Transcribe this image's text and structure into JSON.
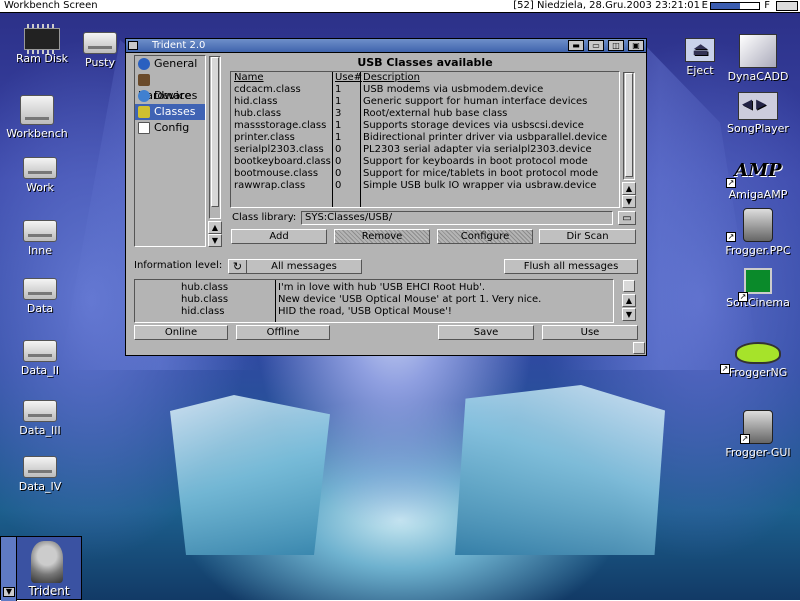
{
  "screen": {
    "title": "Workbench Screen",
    "clock": "[52] Niedziela, 28.Gru.2003 23:21:01",
    "e_label": "E",
    "f_label": "F",
    "e_fill_fraction": 0.6
  },
  "desktop_icons_left": [
    {
      "label": "Ram Disk",
      "icon": "ram-chip-icon"
    },
    {
      "label": "Pusty",
      "icon": "floppy-icon"
    },
    {
      "label": "Workbench",
      "icon": "harddisk-icon"
    },
    {
      "label": "Work",
      "icon": "harddisk-icon"
    },
    {
      "label": "Inne",
      "icon": "harddisk-icon"
    },
    {
      "label": "Data",
      "icon": "harddisk-icon"
    },
    {
      "label": "Data_II",
      "icon": "harddisk-icon"
    },
    {
      "label": "Data_III",
      "icon": "harddisk-icon"
    },
    {
      "label": "Data_IV",
      "icon": "harddisk-icon"
    }
  ],
  "desktop_icons_right": [
    {
      "label": "Eject",
      "icon": "eject-icon"
    },
    {
      "label": "DynaCADD",
      "icon": "cad-icon"
    },
    {
      "label": "SongPlayer",
      "icon": "speaker-icon"
    },
    {
      "label": "AmigaAMP",
      "icon": "amp-logo-icon"
    },
    {
      "label": "Frogger.PPC",
      "icon": "robot-frog-icon"
    },
    {
      "label": "SoftCinema",
      "icon": "monitor-icon"
    },
    {
      "label": "FroggerNG",
      "icon": "frog-icon"
    },
    {
      "label": "Frogger-GUI",
      "icon": "robot-frog-icon"
    }
  ],
  "window": {
    "title": "Trident 2.0",
    "sidebar": [
      {
        "label": "General",
        "selected": false,
        "color": "#2a60c0"
      },
      {
        "label": "Hardware",
        "selected": false,
        "color": "#6a4a2a"
      },
      {
        "label": "Devices",
        "selected": false,
        "color": "#4080d0"
      },
      {
        "label": "Classes",
        "selected": true,
        "color": "#d0c030"
      },
      {
        "label": "Config",
        "selected": false,
        "color": "#909090"
      }
    ],
    "classes_header": "USB Classes available",
    "columns": {
      "name": "Name",
      "use": "Use#",
      "desc": "Description"
    },
    "classes": [
      {
        "name": "cdcacm.class",
        "use": "1",
        "desc": "USB modems via usbmodem.device"
      },
      {
        "name": "hid.class",
        "use": "1",
        "desc": "Generic support for human interface devices"
      },
      {
        "name": "hub.class",
        "use": "3",
        "desc": "Root/external hub base class"
      },
      {
        "name": "massstorage.class",
        "use": "1",
        "desc": "Supports storage devices via usbscsi.device"
      },
      {
        "name": "printer.class",
        "use": "1",
        "desc": "Bidirectional printer driver via usbparallel.device"
      },
      {
        "name": "serialpl2303.class",
        "use": "0",
        "desc": "PL2303 serial adapter via serialpl2303.device"
      },
      {
        "name": "bootkeyboard.class",
        "use": "0",
        "desc": "Support for keyboards in boot protocol mode"
      },
      {
        "name": "bootmouse.class",
        "use": "0",
        "desc": "Support for mice/tablets in boot protocol mode"
      },
      {
        "name": "rawwrap.class",
        "use": "0",
        "desc": "Simple USB bulk IO wrapper via usbraw.device"
      }
    ],
    "class_library_label": "Class library:",
    "class_library_value": "SYS:Classes/USB/",
    "buttons": {
      "add": "Add",
      "remove": "Remove",
      "configure": "Configure",
      "dir_scan": "Dir Scan",
      "flush": "Flush all messages",
      "online": "Online",
      "offline": "Offline",
      "save": "Save",
      "use": "Use"
    },
    "info_level_label": "Information level:",
    "info_level_value": "All messages",
    "log": [
      {
        "source": "hub.class",
        "message": "I'm in love with hub 'USB EHCI Root Hub'."
      },
      {
        "source": "hub.class",
        "message": "New device 'USB Optical Mouse' at port 1. Very nice."
      },
      {
        "source": "hid.class",
        "message": "HID the road, 'USB Optical Mouse'!"
      }
    ]
  },
  "taskbar": {
    "label": "Trident"
  }
}
